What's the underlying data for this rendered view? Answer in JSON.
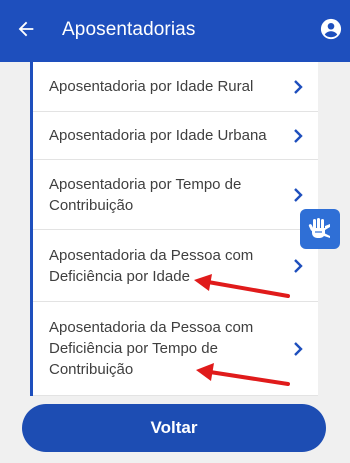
{
  "header": {
    "title": "Aposentadorias",
    "back_icon": "arrow-left-icon",
    "user_icon": "account-circle-icon",
    "background": "#1e4fbd"
  },
  "items": [
    {
      "label": "Aposentadoria por Idade Rural"
    },
    {
      "label": "Aposentadoria por Idade Urbana"
    },
    {
      "label": "Aposentadoria por Tempo de Contribuição"
    },
    {
      "label": "Aposentadoria da Pessoa com Deficiência por Idade"
    },
    {
      "label": "Aposentadoria da Pessoa com Deficiência por Tempo de Contribuição"
    }
  ],
  "libras_button": {
    "icon": "sign-language-hand-icon",
    "color": "#2f6fd6"
  },
  "annotation_color": "#e01b1b",
  "footer": {
    "back_label": "Voltar",
    "button_color": "#1d4db3"
  }
}
